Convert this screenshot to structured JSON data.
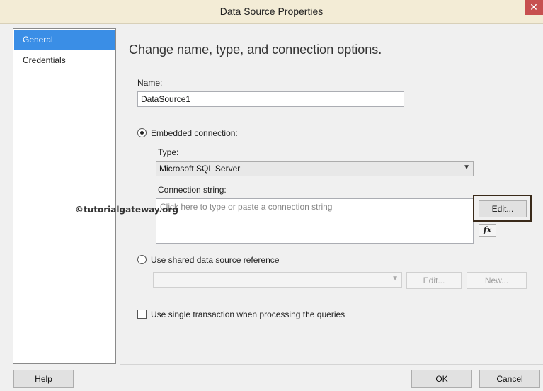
{
  "window": {
    "title": "Data Source Properties",
    "close_glyph": "✕"
  },
  "sidebar": {
    "items": [
      {
        "label": "General",
        "active": true
      },
      {
        "label": "Credentials",
        "active": false
      }
    ]
  },
  "main": {
    "heading": "Change name, type, and connection options.",
    "name_label": "Name:",
    "name_value": "DataSource1",
    "embedded_label": "Embedded connection:",
    "type_label": "Type:",
    "type_value": "Microsoft SQL Server",
    "connection_string_label": "Connection string:",
    "connection_string_placeholder": "Click here to type or paste a connection string",
    "edit_button": "Edit...",
    "fx_button": "fx",
    "shared_label": "Use shared data source reference",
    "shared_edit_button": "Edit...",
    "shared_new_button": "New...",
    "single_transaction_label": "Use single transaction when processing the queries"
  },
  "watermark": "©tutorialgateway.org",
  "footer": {
    "help": "Help",
    "ok": "OK",
    "cancel": "Cancel"
  },
  "colors": {
    "selection": "#3a8ee6",
    "titlebar": "#f3ecd6",
    "close": "#c75050"
  }
}
